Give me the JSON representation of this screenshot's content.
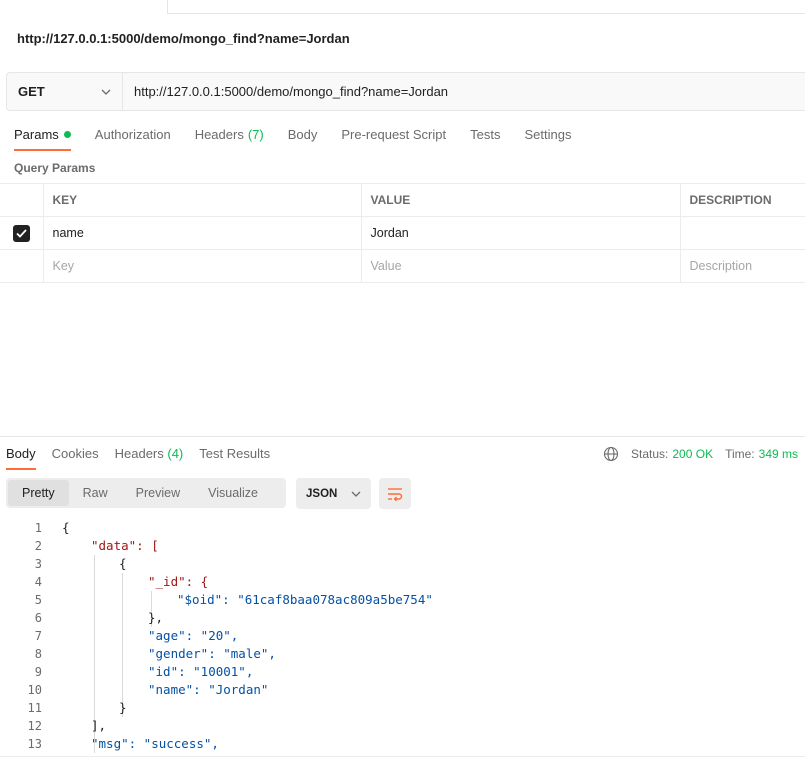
{
  "request": {
    "name": "http://127.0.0.1:5000/demo/mongo_find?name=Jordan",
    "method": "GET",
    "url": "http://127.0.0.1:5000/demo/mongo_find?name=Jordan"
  },
  "request_tabs": [
    {
      "label": "Params",
      "count": "",
      "has_dot": true
    },
    {
      "label": "Authorization",
      "count": ""
    },
    {
      "label": "Headers",
      "count": "(7)"
    },
    {
      "label": "Body",
      "count": ""
    },
    {
      "label": "Pre-request Script",
      "count": ""
    },
    {
      "label": "Tests",
      "count": ""
    },
    {
      "label": "Settings",
      "count": ""
    }
  ],
  "query_params": {
    "section_label": "Query Params",
    "headers": {
      "key": "KEY",
      "value": "VALUE",
      "description": "DESCRIPTION"
    },
    "rows": [
      {
        "checked": true,
        "key": "name",
        "value": "Jordan",
        "description": ""
      }
    ],
    "placeholders": {
      "key": "Key",
      "value": "Value",
      "description": "Description"
    }
  },
  "response_tabs": [
    {
      "label": "Body",
      "count": ""
    },
    {
      "label": "Cookies",
      "count": ""
    },
    {
      "label": "Headers",
      "count": "(4)"
    },
    {
      "label": "Test Results",
      "count": ""
    }
  ],
  "response_status": {
    "status_label": "Status:",
    "status_value": "200 OK",
    "time_label": "Time:",
    "time_value": "349 ms"
  },
  "view_modes": [
    "Pretty",
    "Raw",
    "Preview",
    "Visualize"
  ],
  "format": "JSON",
  "code_lines": [
    "{",
    "\"data\": [",
    "{",
    "\"_id\": {",
    "\"$oid\": \"61caf8baa078ac809a5be754\"",
    "},",
    "\"age\": \"20\",",
    "\"gender\": \"male\",",
    "\"id\": \"10001\",",
    "\"name\": \"Jordan\"",
    "}",
    "],",
    "\"msg\": \"success\","
  ],
  "colors": {
    "accent": "#ff6c37",
    "success": "#0cbb52",
    "json_key": "#a31515",
    "json_string": "#0451a5"
  }
}
